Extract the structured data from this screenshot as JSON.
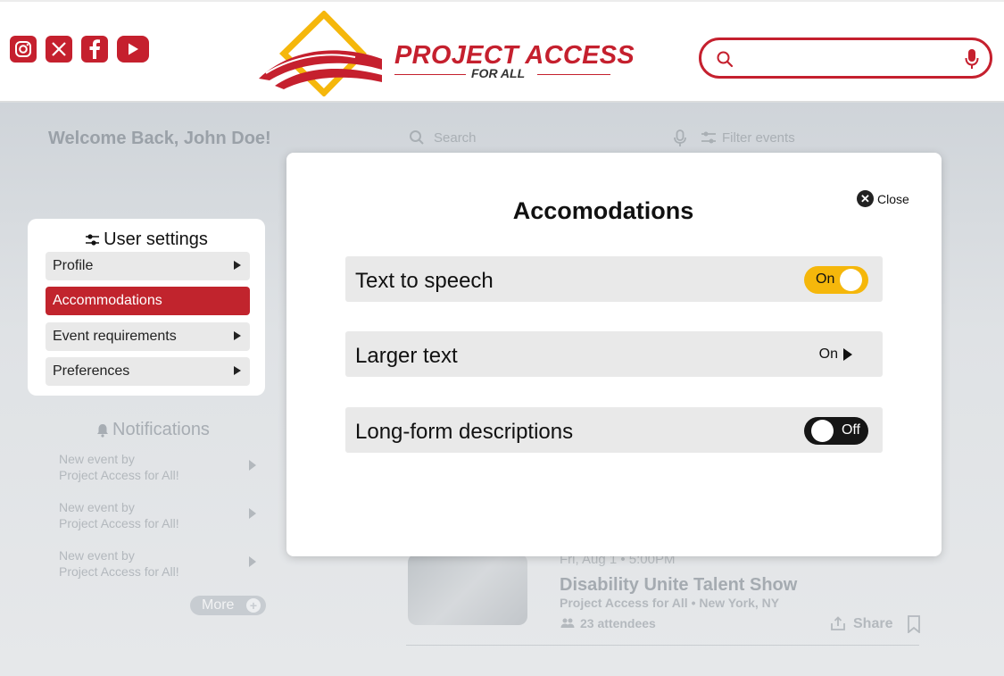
{
  "brand": {
    "name": "PROJECT ACCESS",
    "sub": "FOR ALL",
    "primary_color": "#c5202e",
    "accent_color": "#f5b70b"
  },
  "header": {
    "social_icons": [
      "instagram-icon",
      "x-icon",
      "facebook-icon",
      "youtube-icon"
    ],
    "search_value": ""
  },
  "background": {
    "welcome": "Welcome Back, John Doe!",
    "search_placeholder": "Search",
    "filter_label": "Filter events",
    "notifications_title": "Notifications",
    "notifications": [
      {
        "line1": "New event by",
        "line2": "Project Access for All!"
      },
      {
        "line1": "New event by",
        "line2": "Project Access for All!"
      },
      {
        "line1": "New event by",
        "line2": "Project Access for All!"
      }
    ],
    "more_label": "More",
    "event": {
      "date": "Fri, Aug 1 • 5:00PM",
      "title": "Disability Unite Talent Show",
      "org": "Project Access for All • New York, NY",
      "attendees": "23 attendees",
      "share": "Share"
    }
  },
  "settings": {
    "title": "User settings",
    "items": [
      {
        "label": "Profile",
        "active": false
      },
      {
        "label": "Accommodations",
        "active": true
      },
      {
        "label": "Event requirements",
        "active": false
      },
      {
        "label": "Preferences",
        "active": false
      }
    ]
  },
  "modal": {
    "title": "Accomodations",
    "close_label": "Close",
    "rows": [
      {
        "label": "Text to speech",
        "state": "On",
        "control": "toggle-on"
      },
      {
        "label": "Larger text",
        "state": "On",
        "control": "submenu"
      },
      {
        "label": "Long-form descriptions",
        "state": "Off",
        "control": "toggle-off"
      }
    ]
  }
}
